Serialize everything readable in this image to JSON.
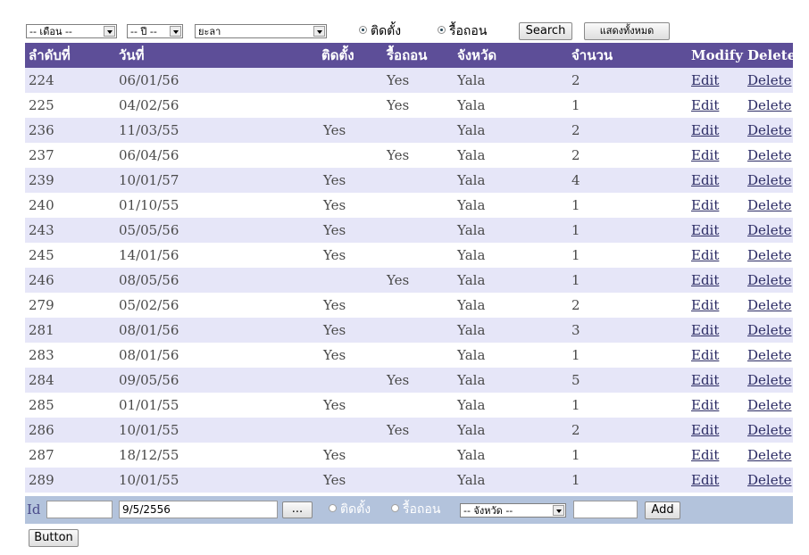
{
  "filters": {
    "month": "-- เดือน --",
    "year": "-- ปี --",
    "province": "ยะลา",
    "radio_install": "ติดตั้ง",
    "radio_remove": "รื้อถอน",
    "search": "Search",
    "show_all": "แสดงทั้งหมด"
  },
  "table": {
    "headers": [
      "ลำดับที่",
      "วันที่",
      "ติดตั้ง",
      "รื้อถอน",
      "จังหวัด",
      "จำนวน",
      "Modify",
      "Delete"
    ],
    "rows": [
      [
        "224",
        "06/01/56",
        "",
        "Yes",
        "Yala",
        "2",
        "Edit",
        "Delete"
      ],
      [
        "225",
        "04/02/56",
        "",
        "Yes",
        "Yala",
        "1",
        "Edit",
        "Delete"
      ],
      [
        "236",
        "11/03/55",
        "Yes",
        "",
        "Yala",
        "2",
        "Edit",
        "Delete"
      ],
      [
        "237",
        "06/04/56",
        "",
        "Yes",
        "Yala",
        "2",
        "Edit",
        "Delete"
      ],
      [
        "239",
        "10/01/57",
        "Yes",
        "",
        "Yala",
        "4",
        "Edit",
        "Delete"
      ],
      [
        "240",
        "01/10/55",
        "Yes",
        "",
        "Yala",
        "1",
        "Edit",
        "Delete"
      ],
      [
        "243",
        "05/05/56",
        "Yes",
        "",
        "Yala",
        "1",
        "Edit",
        "Delete"
      ],
      [
        "245",
        "14/01/56",
        "Yes",
        "",
        "Yala",
        "1",
        "Edit",
        "Delete"
      ],
      [
        "246",
        "08/05/56",
        "",
        "Yes",
        "Yala",
        "1",
        "Edit",
        "Delete"
      ],
      [
        "279",
        "05/02/56",
        "Yes",
        "",
        "Yala",
        "2",
        "Edit",
        "Delete"
      ],
      [
        "281",
        "08/01/56",
        "Yes",
        "",
        "Yala",
        "3",
        "Edit",
        "Delete"
      ],
      [
        "283",
        "08/01/56",
        "Yes",
        "",
        "Yala",
        "1",
        "Edit",
        "Delete"
      ],
      [
        "284",
        "09/05/56",
        "",
        "Yes",
        "Yala",
        "5",
        "Edit",
        "Delete"
      ],
      [
        "285",
        "01/01/55",
        "Yes",
        "",
        "Yala",
        "1",
        "Edit",
        "Delete"
      ],
      [
        "286",
        "10/01/55",
        "",
        "Yes",
        "Yala",
        "2",
        "Edit",
        "Delete"
      ],
      [
        "287",
        "18/12/55",
        "Yes",
        "",
        "Yala",
        "1",
        "Edit",
        "Delete"
      ],
      [
        "289",
        "10/01/55",
        "Yes",
        "",
        "Yala",
        "1",
        "Edit",
        "Delete"
      ]
    ]
  },
  "add_form": {
    "id_label": "Id",
    "id_value": "",
    "date_value": "9/5/2556",
    "picker_label": "...",
    "radio_install": "ติดตั้ง",
    "radio_remove": "รื้อถอน",
    "province_select": "-- จังหวัด --",
    "amount_value": "",
    "add_button": "Add"
  },
  "footer": {
    "button": "Button"
  },
  "colors": {
    "header_bg": "#5d4e98",
    "alt_row_bg": "#e6e6f8",
    "add_row_bg": "#b3c3dc"
  }
}
